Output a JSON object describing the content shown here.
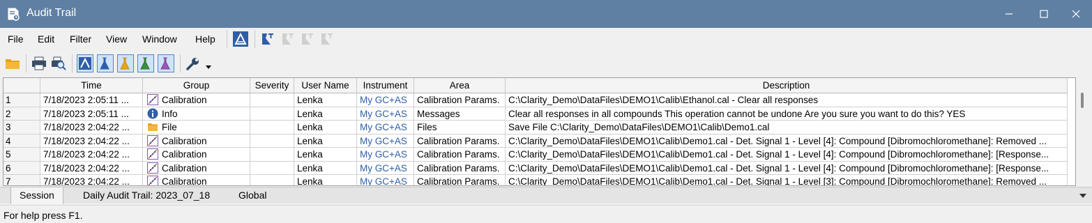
{
  "window": {
    "title": "Audit Trail"
  },
  "menu": [
    "File",
    "Edit",
    "Filter",
    "View",
    "Window",
    "Help"
  ],
  "grid": {
    "columns": [
      "",
      "Time",
      "Group",
      "Severity",
      "User Name",
      "Instrument",
      "Area",
      "Description"
    ],
    "rows": [
      {
        "num": "1",
        "time": "7/18/2023 2:05:11 ...",
        "group": "Calibration",
        "group_icon": "calibration-icon",
        "severity": "",
        "user": "Lenka",
        "instrument": "My GC+AS",
        "area": "Calibration Params.",
        "description": "C:\\Clarity_Demo\\DataFiles\\DEMO1\\Calib\\Ethanol.cal - Clear all responses"
      },
      {
        "num": "2",
        "time": "7/18/2023 2:05:11 ...",
        "group": "Info",
        "group_icon": "info-icon",
        "severity": "",
        "user": "Lenka",
        "instrument": "My GC+AS",
        "area": "Messages",
        "description": "Clear all responses in all compounds This operation cannot be undone Are you sure you want to do this? YES"
      },
      {
        "num": "3",
        "time": "7/18/2023 2:04:22 ...",
        "group": "File",
        "group_icon": "folder-icon",
        "severity": "",
        "user": "Lenka",
        "instrument": "My GC+AS",
        "area": "Files",
        "description": "Save File C:\\Clarity_Demo\\DataFiles\\DEMO1\\Calib\\Demo1.cal"
      },
      {
        "num": "4",
        "time": "7/18/2023 2:04:22 ...",
        "group": "Calibration",
        "group_icon": "calibration-icon",
        "severity": "",
        "user": "Lenka",
        "instrument": "My GC+AS",
        "area": "Calibration Params.",
        "description": "C:\\Clarity_Demo\\DataFiles\\DEMO1\\Calib\\Demo1.cal - Det. Signal 1 - Level [4]: Compound [Dibromochloromethane]: Removed ..."
      },
      {
        "num": "5",
        "time": "7/18/2023 2:04:22 ...",
        "group": "Calibration",
        "group_icon": "calibration-icon",
        "severity": "",
        "user": "Lenka",
        "instrument": "My GC+AS",
        "area": "Calibration Params.",
        "description": "C:\\Clarity_Demo\\DataFiles\\DEMO1\\Calib\\Demo1.cal - Det. Signal 1 - Level [4]: Compound [Dibromochloromethane]: [Response..."
      },
      {
        "num": "6",
        "time": "7/18/2023 2:04:22 ...",
        "group": "Calibration",
        "group_icon": "calibration-icon",
        "severity": "",
        "user": "Lenka",
        "instrument": "My GC+AS",
        "area": "Calibration Params.",
        "description": "C:\\Clarity_Demo\\DataFiles\\DEMO1\\Calib\\Demo1.cal - Det. Signal 1 - Level [4]: Compound [Dibromochloromethane]: [Response..."
      },
      {
        "num": "7",
        "time": "7/18/2023 2:04:22 ...",
        "group": "Calibration",
        "group_icon": "calibration-icon",
        "severity": "",
        "user": "Lenka",
        "instrument": "My GC+AS",
        "area": "Calibration Params.",
        "description": "C:\\Clarity_Demo\\DataFiles\\DEMO1\\Calib\\Demo1.cal - Det. Signal 1 - Level [3]: Compound [Dibromochloromethane]: Removed ..."
      }
    ]
  },
  "tabs": [
    "Session",
    "Daily Audit Trail: 2023_07_18",
    "Global"
  ],
  "status": {
    "text": "For help press F1."
  },
  "colors": {
    "titlebar": "#5f7fa3",
    "instrument_text": "#2e5fa8",
    "selected_toolbar": "#cfe3f7"
  }
}
